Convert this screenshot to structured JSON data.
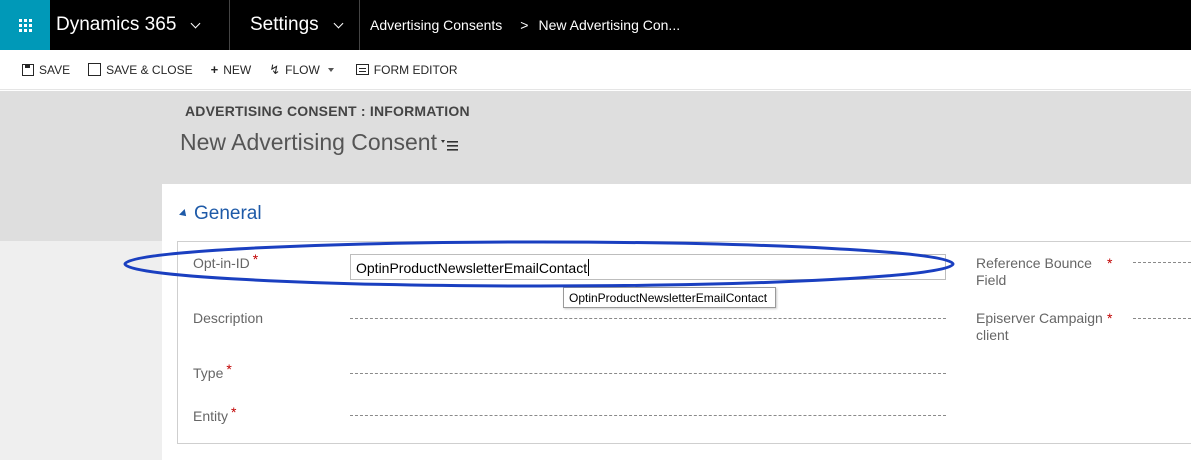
{
  "topnav": {
    "brand": "Dynamics 365",
    "area": "Settings",
    "breadcrumbs": [
      "Advertising Consents",
      "New Advertising Con..."
    ],
    "breadcrumb_sep": ">"
  },
  "toolbar": {
    "save": "SAVE",
    "save_close": "SAVE & CLOSE",
    "new": "NEW",
    "flow": "FLOW",
    "form_editor": "FORM EDITOR"
  },
  "header": {
    "entity_label": "ADVERTISING CONSENT : INFORMATION",
    "record_title": "New Advertising Consent"
  },
  "section": {
    "title": "General"
  },
  "fields": {
    "optin_label": "Opt-in-ID",
    "optin_value": "OptinProductNewsletterEmailContact",
    "optin_tooltip": "OptinProductNewsletterEmailContact",
    "description_label": "Description",
    "type_label": "Type",
    "entity_label": "Entity",
    "reference_bounce_label_1": "Reference Bounce",
    "reference_bounce_label_2": "Field",
    "episerver_label_1": "Episerver Campaign",
    "episerver_label_2": "client",
    "required_marker": "*"
  },
  "colors": {
    "nav_bg": "#000000",
    "waffle_bg": "#0099b8",
    "section_title": "#1e5aa8",
    "required": "#c00000",
    "annotation_ellipse": "#1a3fc0"
  }
}
